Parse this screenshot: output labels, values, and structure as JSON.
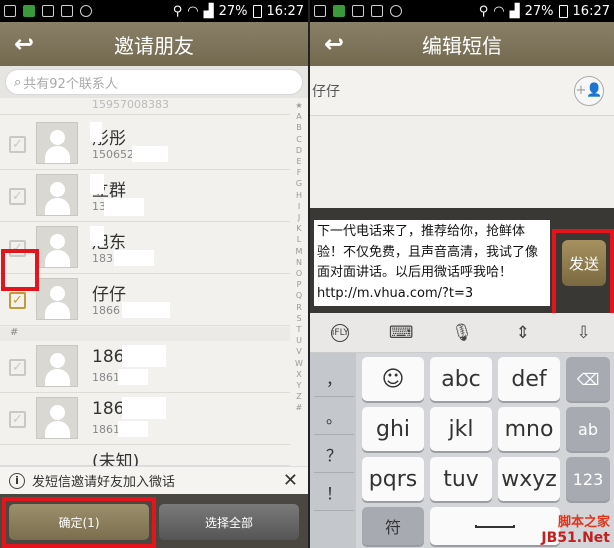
{
  "status": {
    "battery": "27%",
    "time": "16:27"
  },
  "left": {
    "title": "邀请朋友",
    "search_placeholder": "共有92个联系人",
    "alpha_index": [
      "★",
      "A",
      "B",
      "C",
      "D",
      "E",
      "F",
      "G",
      "H",
      "I",
      "J",
      "K",
      "L",
      "M",
      "N",
      "O",
      "P",
      "Q",
      "R",
      "S",
      "T",
      "U",
      "V",
      "W",
      "X",
      "Y",
      "Z",
      "#"
    ],
    "top_number": "15957008383",
    "contacts": [
      {
        "name": "彤彤",
        "number": "1506527",
        "checked": false
      },
      {
        "name": "立群",
        "number": "13 972",
        "checked": false
      },
      {
        "name": "旭东",
        "number": "1835",
        "checked": false
      },
      {
        "name": "仔仔",
        "number": "1866",
        "checked": true
      },
      {
        "name": "186 542",
        "number": "1861 42",
        "checked": false
      },
      {
        "name": "186 542",
        "number": "1861 42",
        "checked": false
      },
      {
        "name": "(未知)",
        "number": "",
        "checked": false
      }
    ],
    "section_hash": "#",
    "notice_text": "发短信邀请好友加入微话",
    "confirm_label": "确定(1)",
    "select_all_label": "选择全部"
  },
  "right": {
    "title": "编辑短信",
    "recipient": "仔仔",
    "message": "下一代电话来了，推荐给你，抢鲜体验！不仅免费，且声音高清，我试了像面对面讲话。以后用微话呼我哈！http://m.vhua.com/?t=3",
    "send_label": "发送",
    "toolbar_icons": [
      "iflytek-icon",
      "keyboard-icon",
      "microphone-icon",
      "cursor-icon",
      "collapse-keyboard-icon"
    ],
    "left_keys": [
      "，",
      "。",
      "？",
      "！"
    ],
    "keys": [
      "☺",
      "abc",
      "def",
      "ghi",
      "jkl",
      "mno",
      "pqrs",
      "tuv",
      "wxyz"
    ],
    "delete_key": "⌫",
    "ab_key": "ab",
    "num_key": "123",
    "symbol_key": "符",
    "watermark_line1": "脚本之家",
    "watermark_line2": "JB51.Net"
  }
}
